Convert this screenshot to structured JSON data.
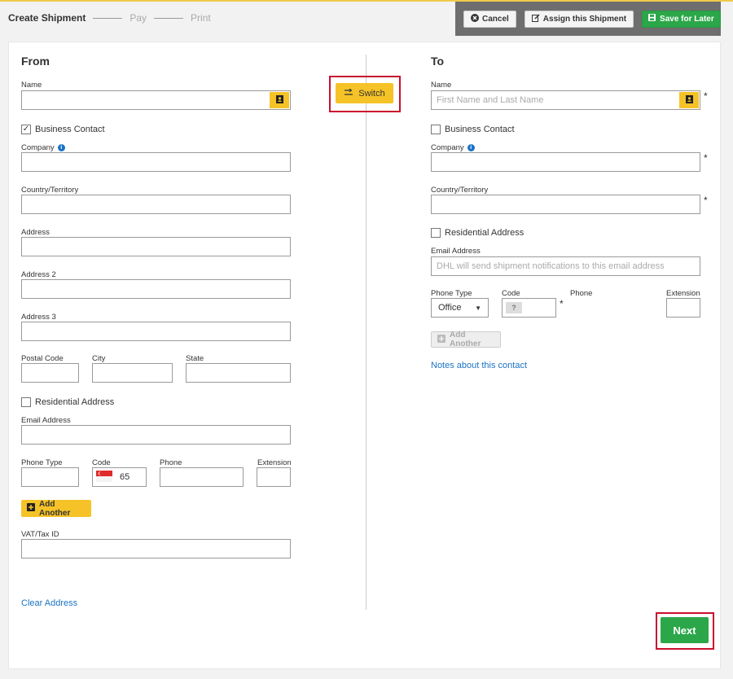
{
  "steps": [
    {
      "label": "Create Shipment"
    },
    {
      "label": "Pay"
    },
    {
      "label": "Print"
    }
  ],
  "actions": {
    "cancel": "Cancel",
    "assign": "Assign this Shipment",
    "save": "Save for Later"
  },
  "switch_label": "Switch",
  "from": {
    "title": "From",
    "name_label": "Name",
    "business_contact": "Business Contact",
    "business_contact_checked": true,
    "company_label": "Company",
    "country_label": "Country/Territory",
    "address_label": "Address",
    "address2_label": "Address 2",
    "address3_label": "Address 3",
    "postal_label": "Postal Code",
    "city_label": "City",
    "state_label": "State",
    "residential": "Residential Address",
    "email_label": "Email Address",
    "phone_type_label": "Phone Type",
    "code_label": "Code",
    "phone_label": "Phone",
    "extension_label": "Extension",
    "code_value": "65",
    "add_another": "Add Another",
    "vat_label": "VAT/Tax ID",
    "clear_address": "Clear Address"
  },
  "to": {
    "title": "To",
    "name_label": "Name",
    "name_placeholder": "First Name and Last Name",
    "business_contact": "Business Contact",
    "company_label": "Company",
    "country_label": "Country/Territory",
    "residential": "Residential Address",
    "email_label": "Email Address",
    "email_placeholder": "DHL will send shipment notifications to this email address",
    "phone_type_label": "Phone Type",
    "phone_type_value": "Office",
    "code_label": "Code",
    "code_placeholder": "?",
    "phone_label": "Phone",
    "extension_label": "Extension",
    "add_another": "Add Another",
    "notes_link": "Notes about this contact",
    "required_mark": "*"
  },
  "next_label": "Next",
  "colors": {
    "accent_yellow": "#f5c327",
    "green": "#2ba74a",
    "link_blue": "#1a73c4",
    "highlight_red": "#c8102e"
  }
}
